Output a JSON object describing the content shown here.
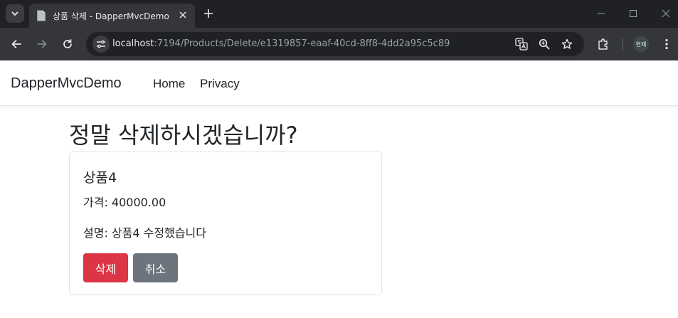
{
  "browser": {
    "tab_title": "상품 삭제 - DapperMvcDemo",
    "url_host": "localhost",
    "url_path": ":7194/Products/Delete/e1319857-eaaf-40cd-8ff8-4dd2a95c5c89",
    "profile_label": "현재",
    "icons": [
      "chevron-down-icon",
      "page-icon",
      "close-icon",
      "plus-icon",
      "minimize-icon",
      "maximize-icon",
      "close-window-icon",
      "back-icon",
      "forward-icon",
      "reload-icon",
      "site-info-icon",
      "translate-icon",
      "zoom-icon",
      "star-icon",
      "extensions-icon",
      "menu-icon"
    ]
  },
  "navbar": {
    "brand": "DapperMvcDemo",
    "links": [
      {
        "label": "Home"
      },
      {
        "label": "Privacy"
      }
    ]
  },
  "main": {
    "heading": "정말 삭제하시겠습니까?",
    "product": {
      "name": "상품4",
      "price_line": "가격: 40000.00",
      "description_line": "설명: 상품4 수정했습니다"
    },
    "delete_label": "삭제",
    "cancel_label": "취소"
  },
  "colors": {
    "danger": "#dc3545",
    "secondary": "#6c757d",
    "chrome_dark": "#202124",
    "chrome_toolbar": "#35363a"
  }
}
